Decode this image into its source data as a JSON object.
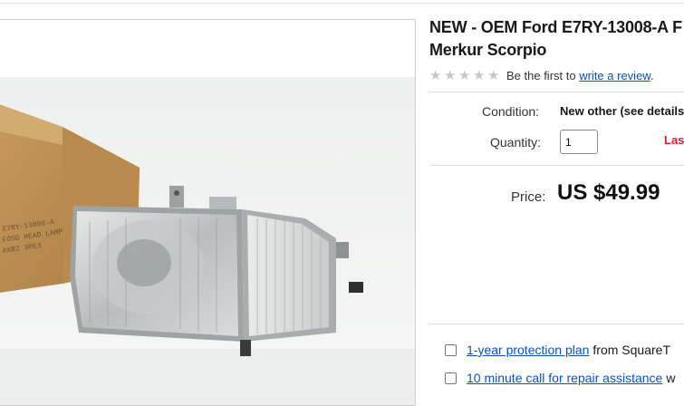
{
  "listing": {
    "title_line1": "NEW - OEM Ford E7RY-13008-A",
    "title_cut": "F",
    "title_line2": "Merkur Scorpio"
  },
  "rating": {
    "stars_filled": 0,
    "stars_total": 5,
    "prefix": "Be the first to",
    "link": "write a review",
    "suffix": "."
  },
  "details": {
    "condition_label": "Condition:",
    "condition_value": "New other (see details",
    "quantity_label": "Quantity:",
    "quantity_value": "1",
    "availability": "Las"
  },
  "price": {
    "label": "Price:",
    "value": "US $49.99"
  },
  "addons": [
    {
      "link": "1-year protection plan",
      "rest": "from SquareT"
    },
    {
      "link": "10 minute call for repair assistance",
      "rest": "w"
    }
  ],
  "colors": {
    "link": "#0654ba",
    "alert": "#dd1e31",
    "star_empty": "#c7c7c7"
  },
  "icons": [
    "star-icon",
    "checkbox-icon"
  ]
}
